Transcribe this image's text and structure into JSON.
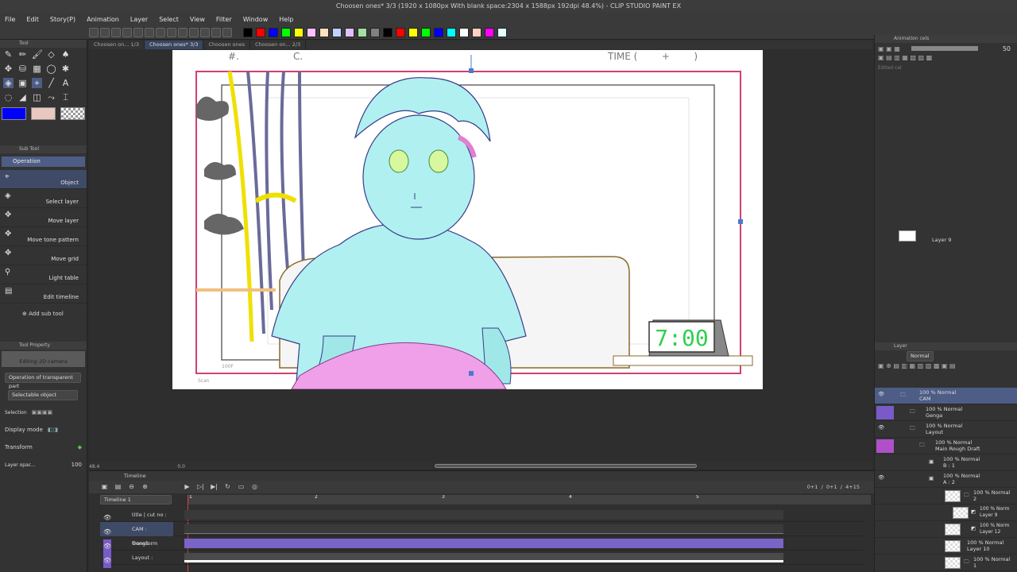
{
  "window": {
    "title": "Choosen ones* 3/3 (1920 x 1080px With blank space:2304 x 1588px 192dpi 48.4%) - CLIP STUDIO PAINT EX"
  },
  "menu": [
    "File",
    "Edit",
    "Story(P)",
    "Animation",
    "Layer",
    "Select",
    "View",
    "Filter",
    "Window",
    "Help"
  ],
  "palette_colors": [
    "#000000",
    "#ff0000",
    "#0000ff",
    "#00ff00",
    "#ffff00",
    "#ffc0ff",
    "#ffe0c0",
    "#c0d0ff",
    "#e0c0ff",
    "#a0e0a0",
    "#808080",
    "#000000",
    "#ff0000",
    "#ffff00",
    "#00ff00",
    "#0000ff",
    "#00ffff",
    "#ffffff",
    "#ffd0c0",
    "#ff00ff",
    "#e0ffff"
  ],
  "document_tabs": [
    {
      "label": "Choosen on... 1/3"
    },
    {
      "label": "Choosen ones* 3/3",
      "active": true
    },
    {
      "label": "Choosen ones"
    },
    {
      "label": "Choosen on... 2/3"
    }
  ],
  "tool_panel": {
    "title": "Tool",
    "main_color": "#0000ff",
    "sub_color": "#e8c8c0"
  },
  "subtool": {
    "title": "Sub Tool",
    "group": "Operation",
    "items": [
      "Object",
      "Select layer",
      "Move layer",
      "Move tone pattern",
      "Move grid",
      "Light table",
      "Edit timeline"
    ],
    "add_label": "Add sub tool"
  },
  "tool_property": {
    "title": "Tool Property",
    "preview_text": "Editing 2D camera",
    "operation": "Operation of transparent part",
    "selectable": "Selectable object",
    "selection_label": "Selection",
    "display_mode_label": "Display mode",
    "transform_label": "Transform",
    "layer_opacity_label": "Layer opac...",
    "layer_opacity_value": "100"
  },
  "canvas": {
    "cut_label": "#.",
    "c_label": "C.",
    "time_label": "TIME (        +        )",
    "clock_text": "7:00",
    "frame_label": "100F",
    "scan_label": "Scan"
  },
  "status": {
    "zoom": "48.4",
    "rotation": "0.0"
  },
  "timeline": {
    "title": "Timeline",
    "dropdown": "Timeline 1",
    "frame_counter": [
      "0+1",
      "/",
      "0+1",
      "/",
      "4+15"
    ],
    "ruler_marks": [
      "1",
      "2",
      "3",
      "4",
      "5"
    ],
    "tracks": [
      {
        "name": "title | cut no :"
      },
      {
        "name": "CAM : Transform"
      },
      {
        "name": "Genga :"
      },
      {
        "name": "Layout :"
      }
    ]
  },
  "animation_cels": {
    "title": "Animation cels",
    "zoom": "50",
    "empty_label": "Edited cel",
    "cel_name": "Layer 9"
  },
  "layer_panel": {
    "title": "Layer",
    "blend_mode": "Normal",
    "layers": [
      {
        "mode": "100 % Normal",
        "name": "CAM",
        "selected": true
      },
      {
        "mode": "100 % Normal",
        "name": "Genga"
      },
      {
        "mode": "100 % Normal",
        "name": "Layout"
      },
      {
        "mode": "100 % Normal",
        "name": "Main Rough Draft"
      },
      {
        "mode": "100 % Normal",
        "name": "B : 1"
      },
      {
        "mode": "100 % Normal",
        "name": "A : 2"
      },
      {
        "mode": "100 % Normal",
        "name": "2"
      },
      {
        "mode": "100 % Norm",
        "name": "Layer 9"
      },
      {
        "mode": "100 % Norm",
        "name": "Layer 12"
      },
      {
        "mode": "100 % Normal",
        "name": "Layer 10"
      },
      {
        "mode": "100 % Normal",
        "name": "1"
      }
    ]
  }
}
